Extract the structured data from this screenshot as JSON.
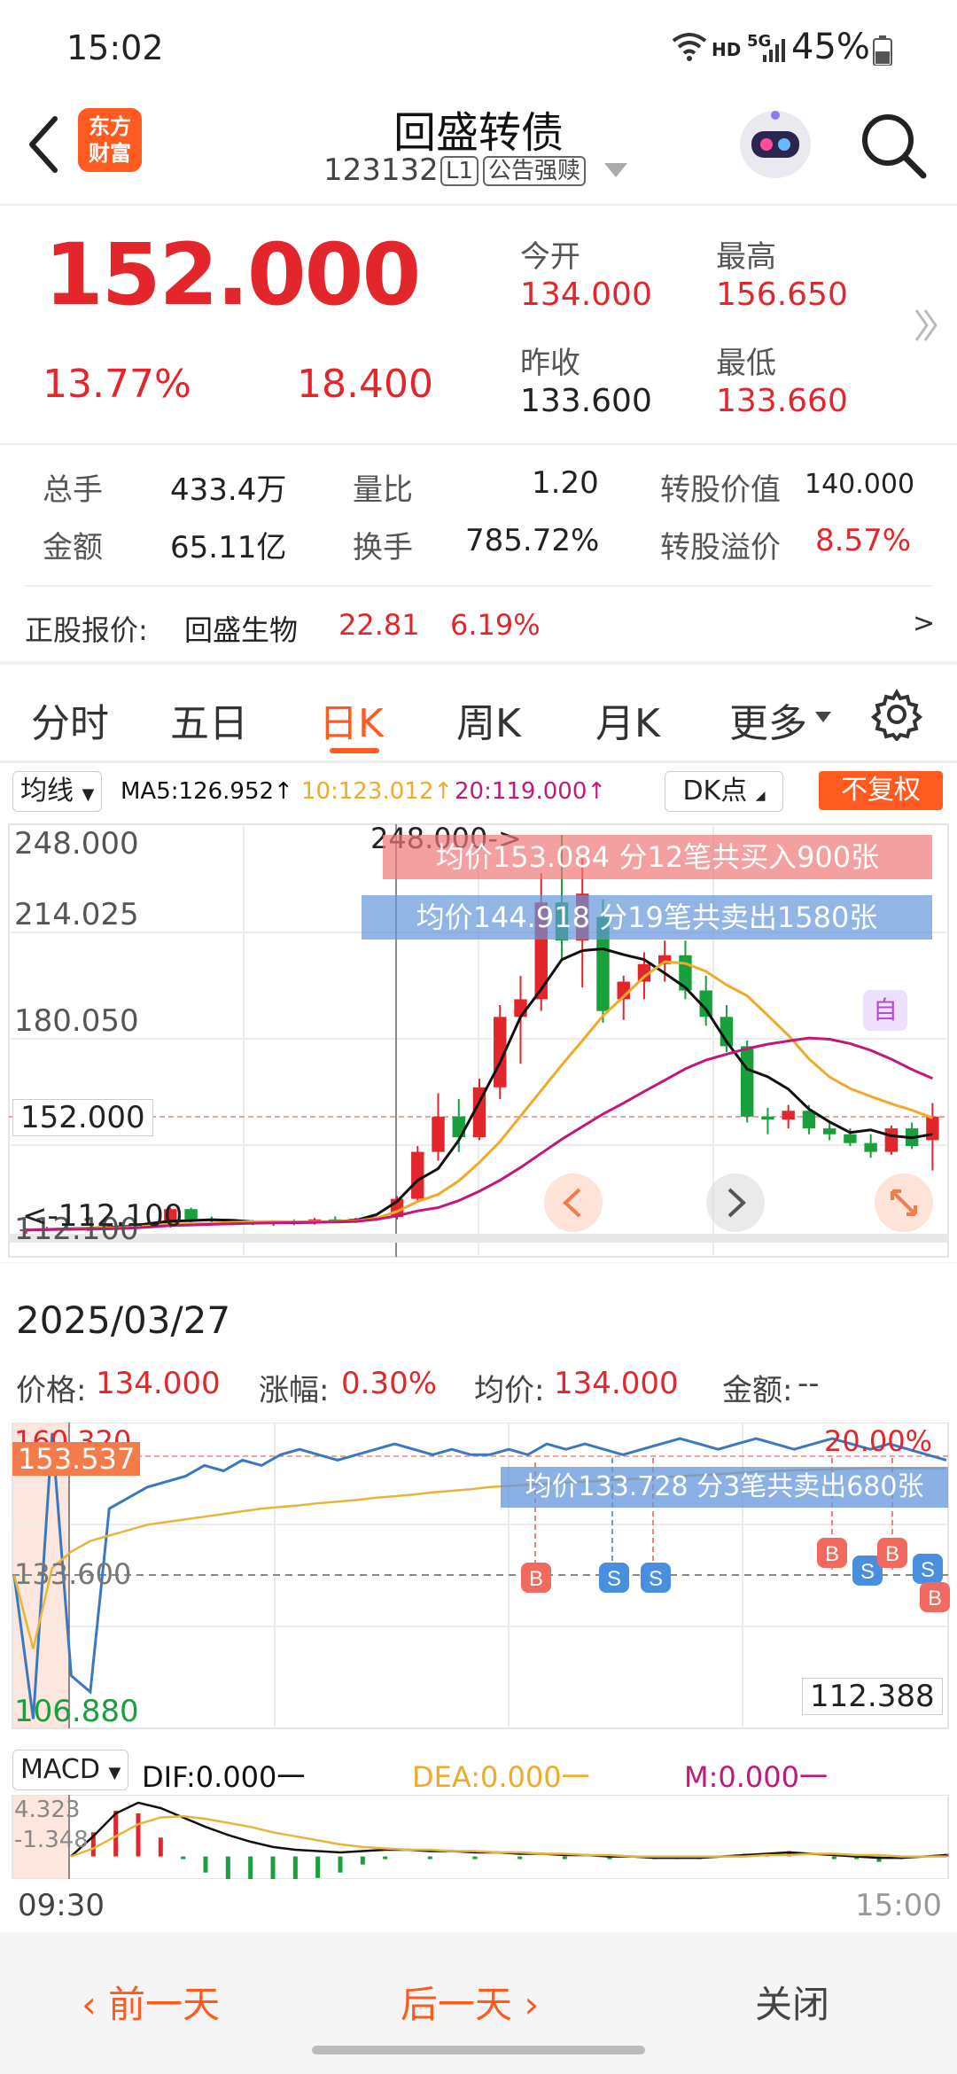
{
  "status_bar": {
    "time": "15:02",
    "network": "HD",
    "signal": "5G",
    "battery": "45%"
  },
  "header": {
    "logo_line1": "东方",
    "logo_line2": "财富",
    "title": "回盛转债",
    "code": "123132",
    "level_badge": "L1",
    "notice_badge": "公告强赎"
  },
  "quote": {
    "price": "152.000",
    "change_pct": "13.77%",
    "change_amt": "18.400",
    "open_label": "今开",
    "open_value": "134.000",
    "high_label": "最高",
    "high_value": "156.650",
    "prev_close_label": "昨收",
    "prev_close_value": "133.600",
    "low_label": "最低",
    "low_value": "133.660"
  },
  "stats": {
    "total_vol_label": "总手",
    "total_vol": "433.4万",
    "vol_ratio_label": "量比",
    "vol_ratio": "1.20",
    "conv_value_label": "转股价值",
    "conv_value": "140.000",
    "amount_label": "金额",
    "amount": "65.11亿",
    "turnover_label": "换手",
    "turnover": "785.72%",
    "conv_premium_label": "转股溢价",
    "conv_premium": "8.57%"
  },
  "underlying": {
    "label": "正股报价:",
    "name": "回盛生物",
    "price": "22.81",
    "pct": "6.19%",
    "arrow": ">"
  },
  "tabs": [
    {
      "label": "分时"
    },
    {
      "label": "五日"
    },
    {
      "label": "日K"
    },
    {
      "label": "周K"
    },
    {
      "label": "月K"
    },
    {
      "label": "更多"
    }
  ],
  "toolbar": {
    "ma_select": "均线",
    "ma5": "MA5:126.952",
    "ma10": "10:123.012",
    "ma20": "20:119.000",
    "dk_label": "DK点",
    "adjust_label": "不复权"
  },
  "kchart_labels": {
    "y_top": "248.000",
    "y_2": "214.025",
    "y_3": "180.050",
    "y_cur": "152.000",
    "y_low": "112.100",
    "high_mark": "248.000->",
    "low_mark": "<-112.100",
    "buy_banner": "均价153.084  分12笔共买入900张",
    "sell_banner": "均价144.918  分19笔共卖出1580张",
    "self_mark": "自"
  },
  "detail": {
    "date": "2025/03/27",
    "price_label": "价格:",
    "price": "134.000",
    "chg_label": "涨幅:",
    "chg": "0.30%",
    "avg_label": "均价:",
    "avg": "134.000",
    "amt_label": "金额:",
    "amt": "--"
  },
  "intraday_labels": {
    "y_top": "160.320",
    "top_pct": "20.00%",
    "cur_price": "153.537",
    "mid": "133.600",
    "low": "106.880",
    "right_low": "112.388",
    "sell_banner": "均价133.728  分3笔共卖出680张"
  },
  "macd": {
    "select": "MACD",
    "dif": "DIF:0.000一",
    "dea": "DEA:0.000一",
    "m": "M:0.000一",
    "y_top": "4.323",
    "y_bot": "-1.348"
  },
  "time_axis": {
    "start": "09:30",
    "end": "15:00"
  },
  "bottom_bar": {
    "prev": "前一天",
    "next": "后一天",
    "close": "关闭"
  },
  "colors": {
    "up": "#e3262b",
    "down": "#18a03c",
    "ma5": "#111111",
    "ma10": "#f0a928",
    "ma20": "#c2187a",
    "brand": "#ff5a1f"
  },
  "chart_data": [
    {
      "type": "candlestick",
      "title": "日K",
      "ylim": [
        112.1,
        248.0
      ],
      "candles": [
        {
          "o": 113.0,
          "h": 114.0,
          "l": 112.1,
          "c": 113.6
        },
        {
          "o": 113.6,
          "h": 114.5,
          "l": 113.0,
          "c": 114.0
        },
        {
          "o": 114.0,
          "h": 115.0,
          "l": 113.2,
          "c": 113.8
        },
        {
          "o": 113.8,
          "h": 114.5,
          "l": 113.0,
          "c": 114.2
        },
        {
          "o": 114.2,
          "h": 115.0,
          "l": 113.4,
          "c": 114.6
        },
        {
          "o": 114.6,
          "h": 115.5,
          "l": 113.8,
          "c": 115.0
        },
        {
          "o": 115.0,
          "h": 116.0,
          "l": 114.0,
          "c": 114.8
        },
        {
          "o": 114.8,
          "h": 121.0,
          "l": 114.2,
          "c": 120.5
        },
        {
          "o": 120.5,
          "h": 121.0,
          "l": 116.0,
          "c": 117.0
        },
        {
          "o": 117.0,
          "h": 118.0,
          "l": 115.5,
          "c": 116.5
        },
        {
          "o": 116.5,
          "h": 117.0,
          "l": 115.0,
          "c": 116.0
        },
        {
          "o": 116.0,
          "h": 116.8,
          "l": 115.0,
          "c": 115.5
        },
        {
          "o": 115.5,
          "h": 116.5,
          "l": 114.8,
          "c": 116.0
        },
        {
          "o": 116.0,
          "h": 117.0,
          "l": 115.0,
          "c": 115.8
        },
        {
          "o": 115.8,
          "h": 117.5,
          "l": 115.2,
          "c": 117.0
        },
        {
          "o": 117.0,
          "h": 118.0,
          "l": 116.0,
          "c": 116.5
        },
        {
          "o": 116.5,
          "h": 117.5,
          "l": 115.8,
          "c": 117.2
        },
        {
          "o": 117.2,
          "h": 118.0,
          "l": 116.5,
          "c": 117.8
        },
        {
          "o": 117.8,
          "h": 125.0,
          "l": 117.0,
          "c": 124.0
        },
        {
          "o": 124.0,
          "h": 142.0,
          "l": 123.0,
          "c": 140.0
        },
        {
          "o": 140.0,
          "h": 160.0,
          "l": 137.0,
          "c": 152.0
        },
        {
          "o": 152.0,
          "h": 158.0,
          "l": 140.0,
          "c": 145.0
        },
        {
          "o": 145.0,
          "h": 165.0,
          "l": 144.0,
          "c": 162.0
        },
        {
          "o": 162.0,
          "h": 190.0,
          "l": 158.0,
          "c": 186.0
        },
        {
          "o": 186.0,
          "h": 200.0,
          "l": 170.0,
          "c": 192.0
        },
        {
          "o": 192.0,
          "h": 235.0,
          "l": 188.0,
          "c": 225.0
        },
        {
          "o": 225.0,
          "h": 248.0,
          "l": 205.0,
          "c": 212.0
        },
        {
          "o": 212.0,
          "h": 240.0,
          "l": 196.0,
          "c": 228.0
        },
        {
          "o": 220.0,
          "h": 226.0,
          "l": 184.0,
          "c": 188.0
        },
        {
          "o": 192.0,
          "h": 200.0,
          "l": 185.0,
          "c": 198.0
        },
        {
          "o": 198.0,
          "h": 208.0,
          "l": 192.0,
          "c": 204.0
        },
        {
          "o": 204.0,
          "h": 212.0,
          "l": 198.0,
          "c": 207.0
        },
        {
          "o": 207.0,
          "h": 212.0,
          "l": 192.0,
          "c": 195.0
        },
        {
          "o": 195.0,
          "h": 200.0,
          "l": 183.0,
          "c": 186.0
        },
        {
          "o": 186.0,
          "h": 190.0,
          "l": 174.0,
          "c": 176.0
        },
        {
          "o": 176.0,
          "h": 178.0,
          "l": 150.0,
          "c": 152.0
        },
        {
          "o": 152.0,
          "h": 155.0,
          "l": 146.0,
          "c": 151.0
        },
        {
          "o": 151.0,
          "h": 156.0,
          "l": 148.0,
          "c": 154.0
        },
        {
          "o": 154.0,
          "h": 156.0,
          "l": 146.0,
          "c": 148.0
        },
        {
          "o": 148.0,
          "h": 150.0,
          "l": 144.0,
          "c": 146.0
        },
        {
          "o": 146.0,
          "h": 148.0,
          "l": 142.0,
          "c": 143.0
        },
        {
          "o": 143.0,
          "h": 146.0,
          "l": 138.0,
          "c": 140.0
        },
        {
          "o": 140.0,
          "h": 149.0,
          "l": 139.0,
          "c": 148.0
        },
        {
          "o": 148.0,
          "h": 150.0,
          "l": 141.0,
          "c": 142.0
        },
        {
          "o": 144.0,
          "h": 156.65,
          "l": 133.66,
          "c": 152.0
        }
      ],
      "ma5": [
        113.4,
        113.6,
        113.8,
        114.0,
        114.3,
        114.6,
        115.6,
        116.4,
        116.6,
        116.9,
        116.7,
        116.2,
        116.1,
        115.9,
        116.0,
        116.3,
        116.7,
        118.6,
        123.1,
        130.3,
        134.3,
        144.0,
        157.0,
        170.4,
        186.0,
        195.4,
        205.5,
        208.6,
        209.2,
        207.2,
        205.5,
        200.9,
        196.0,
        188.6,
        177.6,
        168.2,
        165.6,
        161.4,
        154.6,
        150.2,
        146.6,
        147.5,
        145.5,
        144.8,
        146.0
      ],
      "ma10": [
        113.4,
        113.6,
        113.7,
        113.9,
        114.1,
        114.3,
        114.8,
        115.4,
        115.5,
        115.7,
        116.0,
        116.2,
        116.3,
        116.2,
        116.2,
        116.3,
        116.5,
        117.4,
        119.7,
        123.1,
        125.5,
        130.1,
        136.4,
        143.5,
        152.2,
        160.9,
        169.6,
        177.9,
        186.4,
        192.9,
        199.7,
        204.8,
        204.2,
        201.5,
        196.9,
        193.2,
        186.5,
        179.7,
        171.7,
        165.5,
        161.6,
        158.9,
        156.4,
        154.2,
        151.6
      ],
      "ma20": [
        113.4,
        113.5,
        113.6,
        113.7,
        113.8,
        114.0,
        114.4,
        114.9,
        115.1,
        115.3,
        115.5,
        115.7,
        115.8,
        115.9,
        116.0,
        116.1,
        116.3,
        117.0,
        118.2,
        119.9,
        121.0,
        123.4,
        126.6,
        130.3,
        134.7,
        139.5,
        144.3,
        148.6,
        152.9,
        156.6,
        160.6,
        164.4,
        168.3,
        171.3,
        173.3,
        175.2,
        176.7,
        177.8,
        178.8,
        178.4,
        176.9,
        174.6,
        171.6,
        168.1,
        165.0
      ]
    },
    {
      "type": "line",
      "title": "分时",
      "ylim": [
        106.88,
        160.32
      ],
      "series": [
        {
          "values": [
            133.6,
            107,
            160,
            115,
            112,
            146,
            148,
            150,
            151,
            152,
            154,
            153,
            155,
            154,
            156,
            157,
            156,
            155,
            156,
            157,
            158,
            157,
            156,
            157,
            156,
            156,
            157,
            156,
            158,
            157,
            158,
            157,
            156,
            157,
            158,
            159,
            158,
            157,
            158,
            159,
            158,
            157,
            158,
            159,
            158,
            157,
            158,
            157,
            156,
            155
          ]
        },
        {
          "values": [
            133.6,
            120,
            135,
            138,
            140,
            141,
            142,
            143,
            143.5,
            144,
            144.5,
            145,
            145.5,
            146,
            146.3,
            146.6,
            147,
            147.3,
            147.6,
            148,
            148.3,
            148.6,
            149,
            149.3,
            149.6,
            150,
            150.2,
            150.4,
            150.6,
            150.8,
            151,
            151.2,
            151.4,
            151.6,
            151.8,
            152,
            152.2,
            152.4,
            152.6,
            152.8,
            153,
            153.1,
            153.2,
            153.3,
            153.4,
            153.5,
            153.5,
            153.5,
            153.5,
            153.5
          ]
        }
      ]
    },
    {
      "type": "line",
      "title": "MACD",
      "ylim": [
        -1.348,
        4.323
      ],
      "series": [
        {
          "name": "DIF",
          "values": [
            0,
            1.5,
            3.2,
            4.0,
            3.6,
            2.9,
            2.2,
            1.6,
            1.1,
            0.7,
            0.5,
            0.4,
            0.3,
            0.4,
            0.5,
            0.5,
            0.4,
            0.4,
            0.3,
            0.3,
            0.2,
            0.2,
            0.1,
            0.1,
            0.0,
            0.0,
            -0.1,
            -0.1,
            -0.1,
            0.0,
            0.1,
            0.2,
            0.3,
            0.2,
            0.1,
            0.0,
            -0.1,
            -0.1,
            0.0,
            0.1
          ]
        },
        {
          "name": "DEA",
          "values": [
            0,
            0.6,
            1.5,
            2.4,
            2.9,
            3.0,
            2.8,
            2.5,
            2.2,
            1.8,
            1.5,
            1.2,
            0.9,
            0.7,
            0.6,
            0.5,
            0.5,
            0.4,
            0.4,
            0.3,
            0.3,
            0.2,
            0.2,
            0.1,
            0.1,
            0.0,
            0.0,
            0.0,
            0.0,
            0.0,
            0.0,
            0.1,
            0.1,
            0.2,
            0.2,
            0.1,
            0.1,
            0.0,
            0.0,
            0.0
          ]
        }
      ]
    }
  ]
}
